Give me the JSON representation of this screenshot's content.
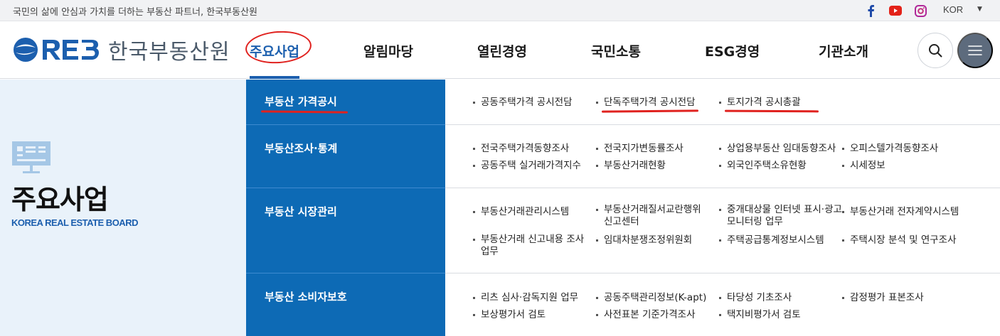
{
  "topbar": {
    "slogan": "국민의 삶에 안심과 가치를 더하는 부동산 파트너, 한국부동산원",
    "social_icons": [
      "facebook-icon",
      "youtube-icon",
      "instagram-icon"
    ],
    "language": "KOR"
  },
  "header": {
    "logo_text": "한국부동산원",
    "logo_mark": "REB",
    "nav": [
      "주요사업",
      "알림마당",
      "열린경영",
      "국민소통",
      "ESG경영",
      "기관소개"
    ],
    "active_nav": "주요사업"
  },
  "side": {
    "title": "주요사업",
    "subtitle": "KOREA REAL ESTATE BOARD"
  },
  "categories": [
    {
      "label": "부동산 가격공시",
      "links": [
        "공동주택가격 공시전담",
        "단독주택가격 공시전담",
        "토지가격 공시총괄"
      ]
    },
    {
      "label": "부동산조사·통계",
      "links": [
        "전국주택가격동향조사",
        "전국지가변동률조사",
        "상업용부동산 임대동향조사",
        "오피스텔가격동향조사",
        "공동주택 실거래가격지수",
        "부동산거래현황",
        "외국인주택소유현황",
        "시세정보"
      ]
    },
    {
      "label": "부동산 시장관리",
      "links": [
        "부동산거래관리시스템",
        "부동산거래질서교란행위 신고센터",
        "중개대상물 인터넷 표시·광고 모니터링 업무",
        "부동산거래 전자계약시스템",
        "부동산거래 신고내용 조사 업무",
        "임대차분쟁조정위원회",
        "주택공급통계정보시스템",
        "주택시장 분석 및 연구조사"
      ]
    },
    {
      "label": "부동산 소비자보호",
      "links": [
        "리츠 심사·감독지원 업무",
        "공동주택관리정보(K-apt)",
        "타당성 기초조사",
        "감정평가 표본조사",
        "보상평가서 검토",
        "사전표본 기준가격조사",
        "택지비평가서 검토"
      ]
    }
  ],
  "colors": {
    "brand_blue": "#0d6ab5",
    "accent_blue": "#1c5fae",
    "annotation_red": "#e0221f",
    "side_bg": "#e9f2fa"
  }
}
